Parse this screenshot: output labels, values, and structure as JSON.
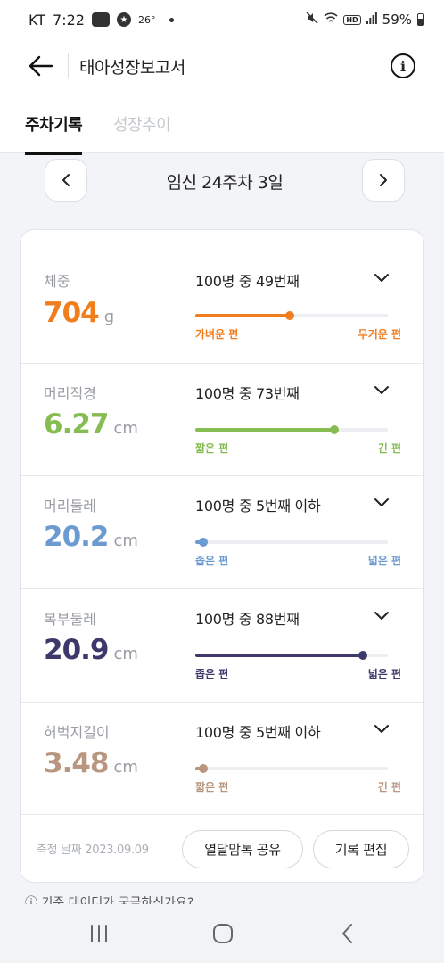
{
  "status_bar": {
    "carrier": "KT",
    "time": "7:22",
    "temperature": "26°",
    "battery": "59%",
    "icons": [
      "news-badge-icon",
      "star-badge-icon",
      "mute-icon",
      "wifi-icon",
      "hd-icon",
      "signal-icon",
      "battery-icon"
    ]
  },
  "header": {
    "title": "태아성장보고서",
    "back_icon": "arrow-left-icon",
    "info_icon": "info-icon",
    "info_glyph": "i"
  },
  "tabs": [
    {
      "label": "주차기록",
      "active": true
    },
    {
      "label": "성장추이",
      "active": false
    }
  ],
  "week_nav": {
    "label": "임신 24주차 3일",
    "prev_icon": "chevron-left-icon",
    "next_icon": "chevron-right-icon"
  },
  "metrics": [
    {
      "name": "체중",
      "value": "704",
      "unit": "g",
      "rank": "100명 중 49번째",
      "percentile": 0.49,
      "low_label": "가벼운 편",
      "high_label": "무거운 편",
      "color": "#f07d1e"
    },
    {
      "name": "머리직경",
      "value": "6.27",
      "unit": "cm",
      "rank": "100명 중 73번째",
      "percentile": 0.72,
      "low_label": "짧은 편",
      "high_label": "긴 편",
      "color": "#86bd52"
    },
    {
      "name": "머리둘레",
      "value": "20.2",
      "unit": "cm",
      "rank": "100명 중 5번째 이하",
      "percentile": 0.04,
      "low_label": "좁은 편",
      "high_label": "넓은 편",
      "color": "#6b9bd1"
    },
    {
      "name": "복부둘레",
      "value": "20.9",
      "unit": "cm",
      "rank": "100명 중 88번째",
      "percentile": 0.87,
      "low_label": "좁은 편",
      "high_label": "넓은 편",
      "color": "#3d3a6b"
    },
    {
      "name": "허벅지길이",
      "value": "3.48",
      "unit": "cm",
      "rank": "100명 중 5번째 이하",
      "percentile": 0.04,
      "low_label": "짧은 편",
      "high_label": "긴 편",
      "color": "#b89680"
    }
  ],
  "footer": {
    "measure_date": "측정 날짜 2023.09.09",
    "share_button": "열달맘톡 공유",
    "edit_button": "기록 편집"
  },
  "bottom_peek": "ⓘ 기준 데이터가 궁금하신가요?",
  "system_nav": [
    "recent-apps-icon",
    "home-icon",
    "back-icon"
  ]
}
